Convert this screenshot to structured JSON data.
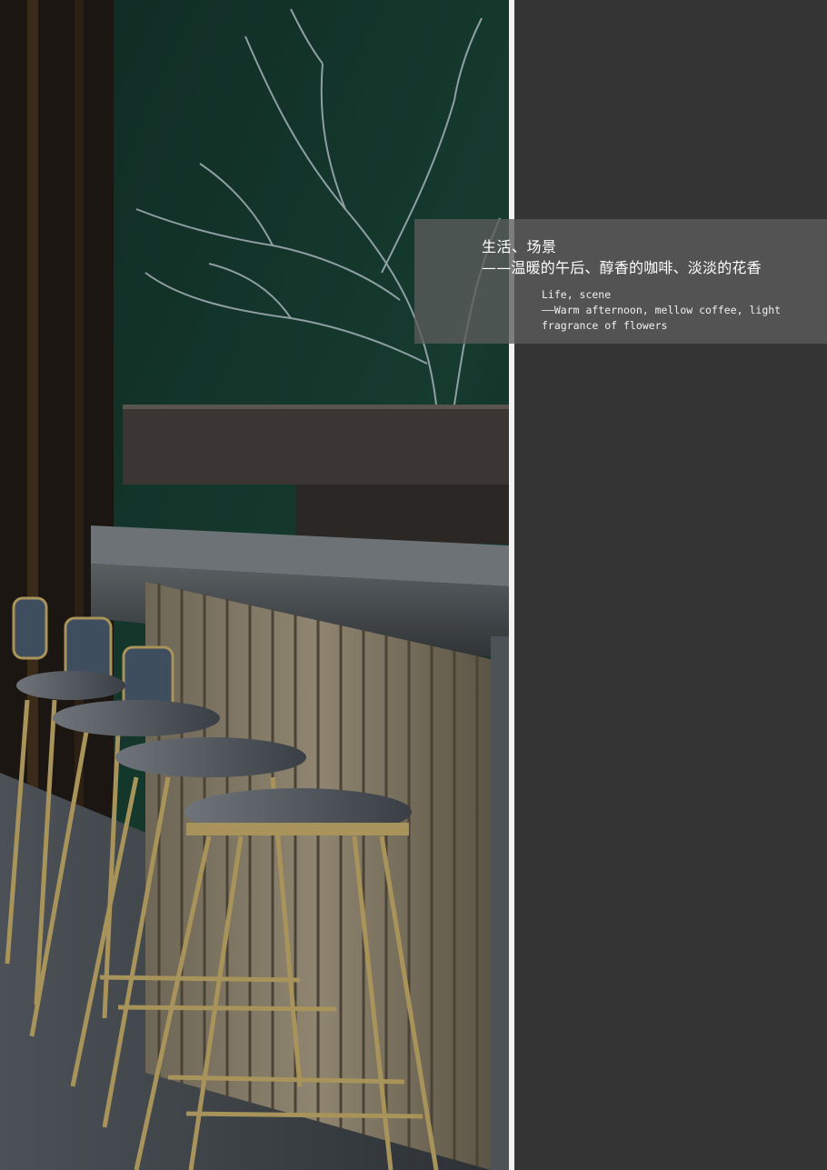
{
  "caption": {
    "cn_title": "生活、场景",
    "cn_subtitle": "——温暖的午后、醇香的咖啡、淡淡的花香",
    "en_line1": "Life, scene",
    "en_line2": "——Warm afternoon, mellow coffee, light",
    "en_line3": "fragrance of flowers"
  },
  "colors": {
    "panel": "#353535",
    "caption_band": "#5c5c5c",
    "divider": "#f2f2f2",
    "text": "#ffffff"
  }
}
